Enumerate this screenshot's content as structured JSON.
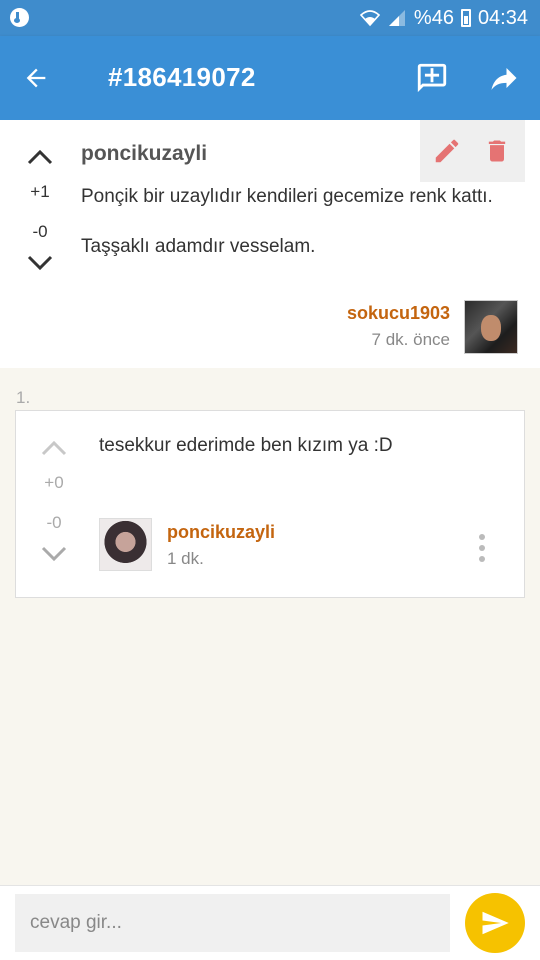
{
  "status_bar": {
    "battery": "%46",
    "time": "04:34",
    "icons": [
      "music-icon",
      "wifi-icon",
      "signal-icon",
      "battery-icon"
    ]
  },
  "header": {
    "title": "#186419072",
    "icons": [
      "back-arrow-icon",
      "add-comment-icon",
      "share-icon"
    ],
    "background": "#3a8fd6"
  },
  "entry": {
    "author": "poncikuzayli",
    "upvotes": "+1",
    "downvotes": "-0",
    "body": [
      "Ponçik bir uzaylıdır kendileri gecemize renk kattı.",
      "Taşşaklı adamdır vesselam."
    ],
    "signer": "sokucu1903",
    "time": "7 dk. önce",
    "action_icons": [
      "pencil-icon",
      "trash-icon"
    ],
    "action_color": "#e57373"
  },
  "reply": {
    "index": "1.",
    "upvotes": "+0",
    "downvotes": "-0",
    "text": "tesekkur ederimde ben kızım ya :D",
    "author": "poncikuzayli",
    "time": "1 dk."
  },
  "composer": {
    "placeholder": "cevap gir...",
    "send_color": "#f6c200"
  },
  "colors": {
    "username": "#c4650f",
    "page_background": "#f8f6ef"
  }
}
